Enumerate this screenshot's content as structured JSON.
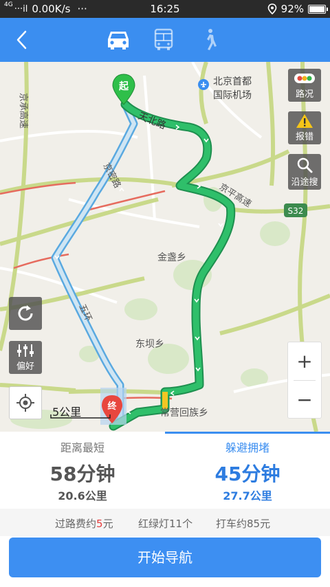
{
  "status_bar": {
    "network_label": "4G",
    "signal_text": "···il",
    "speed": "0.00K/s",
    "dots": "···",
    "time": "16:25",
    "battery": "92%",
    "battery_level": 0.92
  },
  "header": {
    "back_icon": "chevron-left-icon",
    "tabs": [
      {
        "icon": "car-icon",
        "active": true
      },
      {
        "icon": "bus-icon",
        "active": false
      },
      {
        "icon": "walk-icon",
        "active": false
      }
    ]
  },
  "map": {
    "labels": {
      "airport": "北京首都",
      "airport2": "国际机场",
      "tianbei": "天北路",
      "jingmi": "京密路",
      "jingjie": "京承高速",
      "jingping": "京平高速",
      "s32": "S32",
      "jinzhan": "金盏乡",
      "dongba": "东坝乡",
      "changying": "常营回族乡",
      "wuhuan": "五环"
    },
    "start_marker": "起",
    "end_marker": "终",
    "buttons": {
      "traffic": "路况",
      "report": "报错",
      "search_along": "沿途搜",
      "preference": "偏好"
    },
    "zoom_in": "+",
    "zoom_out": "−",
    "scale": "5公里"
  },
  "routes": [
    {
      "tag": "距离最短",
      "time": "58分钟",
      "distance": "20.6公里",
      "selected": false
    },
    {
      "tag": "躲避拥堵",
      "time": "45分钟",
      "distance": "27.7公里",
      "selected": true
    }
  ],
  "info": {
    "toll_prefix": "过路费约",
    "toll_amount": "5",
    "toll_unit": "元",
    "lights": "红绿灯11个",
    "taxi": "打车约85元"
  },
  "start_button": "开始导航",
  "colors": {
    "accent": "#3b8ef0",
    "route_green": "#2fbf6a",
    "route_alt": "#8ec8ea",
    "toll_red": "#e63b3b"
  }
}
